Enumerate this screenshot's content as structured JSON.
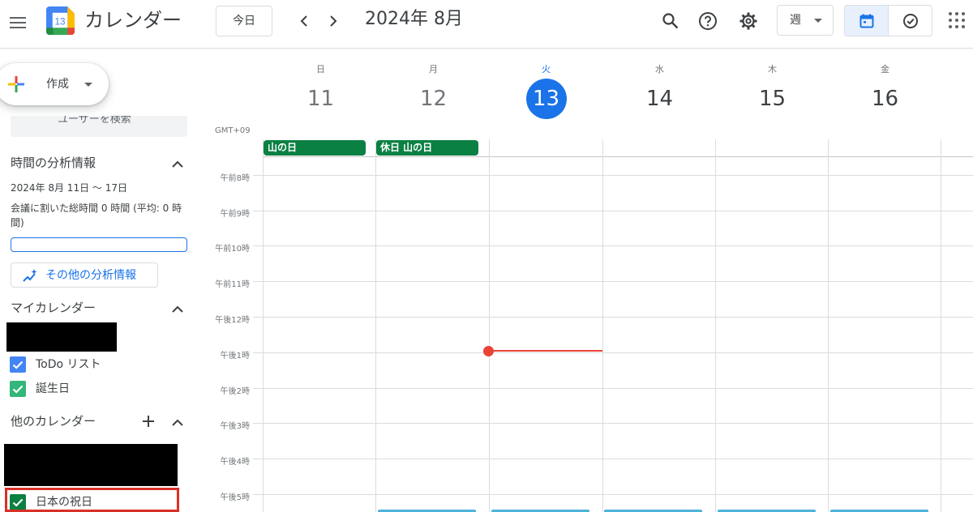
{
  "header": {
    "app_title": "カレンダー",
    "logo_day": "13",
    "today_label": "今日",
    "period": "2024年 8月",
    "view_label": "週",
    "icons": [
      "menu-icon",
      "search-icon",
      "help-icon",
      "settings-icon",
      "calendar-view-icon",
      "tasks-icon",
      "apps-icon"
    ]
  },
  "sidebar": {
    "create_label": "作成",
    "search_people": "ユーザーを検索",
    "insights": {
      "title": "時間の分析情報",
      "range": "2024年 8月 11日 〜 17日",
      "summary": "会議に割いた総時間 0 時間 (平均: 0 時間)",
      "more_button": "その他の分析情報"
    },
    "my_calendars": {
      "title": "マイカレンダー",
      "items": [
        {
          "label": "ToDo リスト",
          "color": "#4285f4"
        },
        {
          "label": "誕生日",
          "color": "#33b679"
        }
      ]
    },
    "other_calendars": {
      "title": "他のカレンダー",
      "items": [
        {
          "label": "日本の祝日",
          "color": "#0b8043"
        }
      ]
    }
  },
  "calendar": {
    "timezone": "GMT+09",
    "days": [
      {
        "dow": "日",
        "date": "11"
      },
      {
        "dow": "月",
        "date": "12"
      },
      {
        "dow": "火",
        "date": "13"
      },
      {
        "dow": "水",
        "date": "14"
      },
      {
        "dow": "木",
        "date": "15"
      },
      {
        "dow": "金",
        "date": "16"
      }
    ],
    "all_day_events": [
      {
        "title": "山の日",
        "color": "#0b8043"
      },
      {
        "title": "休日 山の日",
        "color": "#0b8043"
      }
    ],
    "time_labels": [
      "午前8時",
      "午前9時",
      "午前10時",
      "午前11時",
      "午後12時",
      "午後1時",
      "午後2時",
      "午後3時",
      "午後4時",
      "午後5時"
    ]
  }
}
